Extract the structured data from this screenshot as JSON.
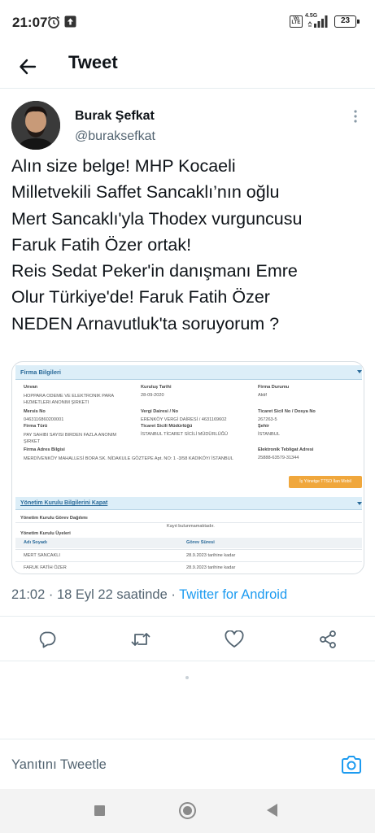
{
  "status_bar": {
    "time": "21:07",
    "volte_label": "Vo LTE",
    "network": "4.5G",
    "battery": "23"
  },
  "header": {
    "title": "Tweet",
    "back_icon": "arrow-left-icon"
  },
  "tweet": {
    "author_name": "Burak Şefkat",
    "author_handle": "@buraksefkat",
    "text_lines": [
      "Alın size belge! MHP Kocaeli",
      "Milletvekili Saffet Sancaklı’nın oğlu",
      "Mert Sancaklı'yla Thodex vurguncusu",
      "Faruk Fatih Özer ortak!",
      "Reis Sedat Peker'in danışmanı Emre",
      "Olur Türkiye'de!  Faruk Fatih Özer",
      "NEDEN Arnavutluk'ta soruyorum ?"
    ],
    "time": "21:02",
    "date": "18 Eyl 22 saatinde",
    "separator": "·",
    "source": "Twitter for Android"
  },
  "document": {
    "section1_title": "Firma Bilgileri",
    "labels": {
      "unvan": "Unvan",
      "kurulus": "Kuruluş Tarihi",
      "durum": "Firma Durumu",
      "mersis": "Mersis No",
      "vergi": "Vergi Dairesi / No",
      "sicil": "Ticaret Sicil No / Dosya No",
      "turu": "Firma Türü",
      "mudurluk": "Ticaret Sicili Müdürlüğü",
      "sehir": "Şehir",
      "adres": "Firma Adres Bilgisi",
      "tebligat": "Elektronik Tebligat Adresi"
    },
    "values": {
      "unvan": "HOPPARA ODEME VE ELEKTRONIK PARA HIZMETLERI ANONIM ŞIRKETI",
      "kurulus": "28-09-2020",
      "durum": "Aktif",
      "mersis": "0463116860200001",
      "vergi": "ERENKÖY VERGİ DAİRESİ / 4631169602",
      "sicil": "267263-5",
      "turu": "PAY SAHIBI SAYISI BIRDEN FAZLA ANONIM ŞIRKET",
      "mudurluk": "İSTANBUL TİCARET SİCİLİ MÜDÜRLÜĞÜ",
      "sehir": "İSTANBUL",
      "adres": "MERDİVENKÖY MAHALLESİ BORA SK. NİDAKULE GÖZTEPE Apt. NO: 1 -3/58 KADIKÖY/ İSTANBUL",
      "tebligat": "25888-63579-31344"
    },
    "orange_button": "İş Yönetge TTSO İlan Mobil",
    "section2_title": "Yönetim Kurulu Bilgilerini Kapat",
    "gorev_title": "Yönetim Kurulu Görev Dağılımı",
    "empty_msg": "Kayıt bulunmamaktadır.",
    "uyeler_title": "Yönetim Kurulu Üyeleri",
    "col_name": "Adı Soyadı",
    "col_sure": "Görev Süresi",
    "rows": [
      {
        "name": "MERT SANCAKLI",
        "sure": "28.9.2023 tarihine kadar"
      },
      {
        "name": "FARUK FATİH ÖZER",
        "sure": "28.9.2023 tarihine kadar"
      }
    ]
  },
  "reply": {
    "placeholder": "Yanıtını Tweetle"
  },
  "icons": [
    "back-icon",
    "alarm-icon",
    "upload-icon",
    "more-icon",
    "reply-icon",
    "retweet-icon",
    "like-icon",
    "share-icon",
    "camera-icon"
  ],
  "colors": {
    "accent": "#1d9bf0",
    "secondary_text": "#536471",
    "doc_header": "#dceef8",
    "doc_button": "#f0a73c"
  }
}
